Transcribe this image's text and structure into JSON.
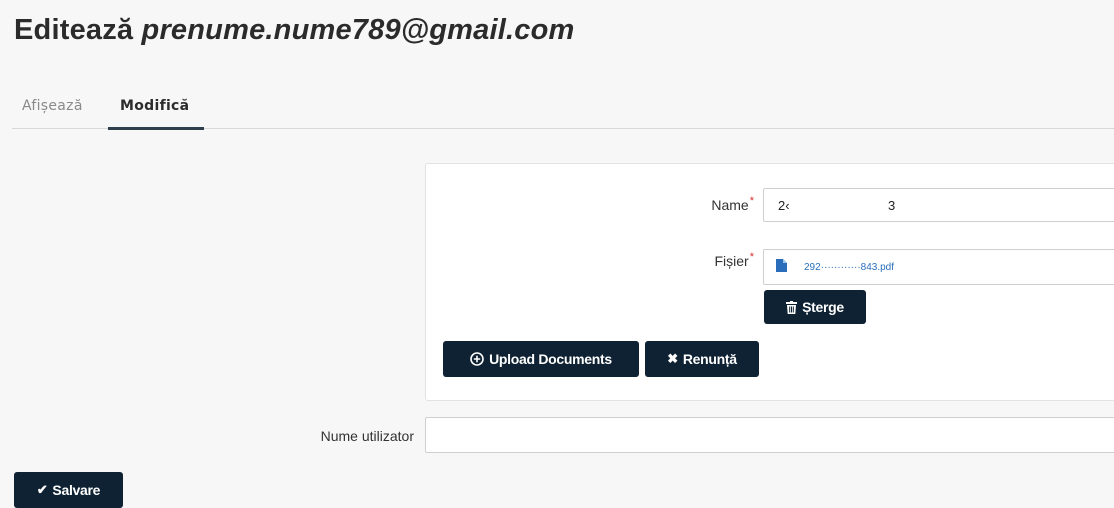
{
  "header": {
    "title_prefix": "Editează",
    "title_email": "prenume.nume789@gmail.com"
  },
  "tabs": [
    {
      "label": "Afișează",
      "active": false
    },
    {
      "label": "Modifică",
      "active": true
    }
  ],
  "form": {
    "name_label": "Name",
    "name_value_part1": "2‹",
    "name_value_part2": "3",
    "file_label": "Fișier",
    "file_name": "292············843.pdf",
    "delete_label": "Șterge",
    "upload_label": "Upload Documents",
    "cancel_label": "Renunță",
    "username_label": "Nume utilizator",
    "username_value": ""
  },
  "footer": {
    "save_label": "Salvare"
  },
  "colors": {
    "button_bg": "#0e2233",
    "link": "#2a6ebb",
    "required": "#e02b2b",
    "tab_underline": "#2f3e4c"
  },
  "icons": {
    "file": "file-icon",
    "delete": "trash-icon",
    "upload": "circle-plus-icon",
    "cancel": "close-icon",
    "save": "check-icon"
  }
}
